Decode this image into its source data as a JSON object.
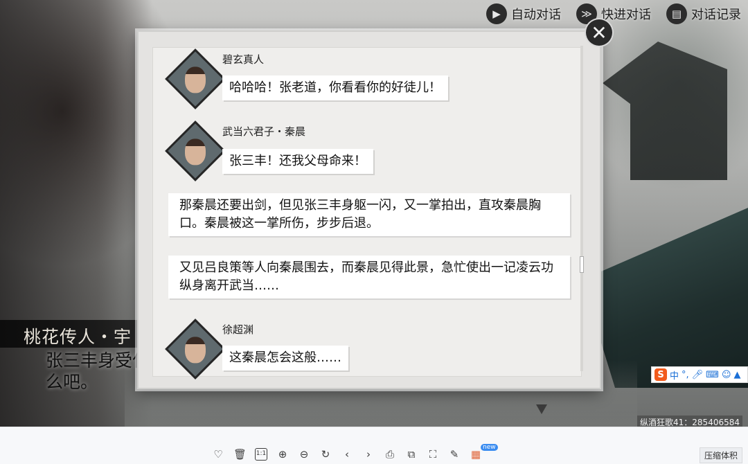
{
  "top_controls": {
    "auto_dialog": "自动对话",
    "fast_forward": "快进对话",
    "dialog_log": "对话记录"
  },
  "speaker_banner": "桃花传人・宇",
  "subtitle": "张三丰身受什么吧。",
  "watermark": "纵酒狂歌41：285406584",
  "log": {
    "entries": [
      {
        "speaker": "碧玄真人",
        "text": "哈哈哈！张老道，你看看你的好徒儿！"
      },
      {
        "speaker": "武当六君子・秦晨",
        "text": "张三丰！还我父母命来！"
      },
      {
        "narration": "那秦晨还要出剑，但见张三丰身躯一闪，又一掌拍出，直攻秦晨胸口。秦晨被这一掌所伤，步步后退。"
      },
      {
        "narration": "又见吕良策等人向秦晨围去，而秦晨见得此景，急忙使出一记凌云功纵身离开武当……"
      },
      {
        "speaker": "徐超渊",
        "text": "这秦晨怎会这般……"
      }
    ]
  },
  "ime": {
    "logo": "S",
    "mode": "中",
    "punct": "°,"
  },
  "toolbar": {
    "ratio_label": "1:1",
    "new_badge": "new",
    "compress": "压缩体积"
  },
  "colors": {
    "panel": "#e4e3e1",
    "bubble": "#ffffff",
    "ime_logo": "#f25b1c",
    "badge": "#3a8cf0"
  }
}
